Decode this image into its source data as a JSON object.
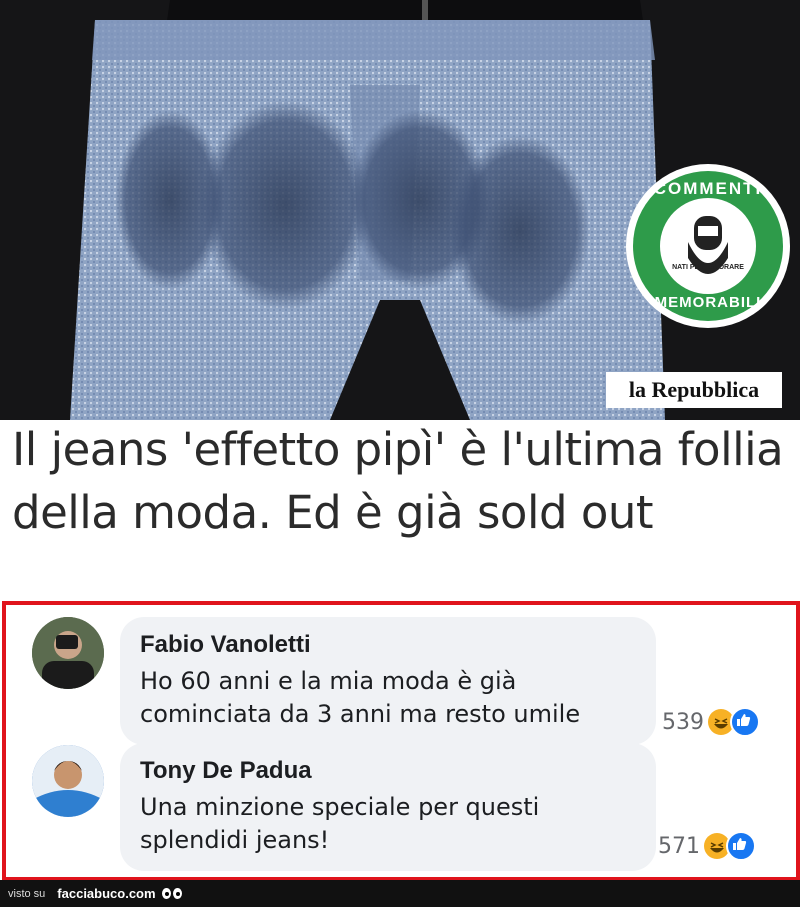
{
  "image": {
    "description_icon": "pants-photo",
    "badge": {
      "top_text": "COMMENTI",
      "bottom_text": "MEMORABILI",
      "inner_text": "NATI PER IGNORARE",
      "color": "#2e9b4a"
    },
    "source_logo": "la Repubblica"
  },
  "headline": "Il jeans 'effetto pipì' è l'ultima follia della moda. Ed è già sold out",
  "comments": [
    {
      "author": "Fabio Vanoletti",
      "text": "Ho 60 anni e la mia moda è già cominciata da 3 anni ma resto umile",
      "reactions": "539"
    },
    {
      "author": "Tony De Padua",
      "text": "Una minzione speciale per questi splendidi jeans!",
      "reactions": "571"
    }
  ],
  "footer": {
    "visto_su": "visto su",
    "site": "facciabuco.com"
  },
  "colors": {
    "frame": "#e0141c",
    "bubble": "#f0f2f5",
    "like": "#1877f2",
    "haha": "#f7b125"
  }
}
